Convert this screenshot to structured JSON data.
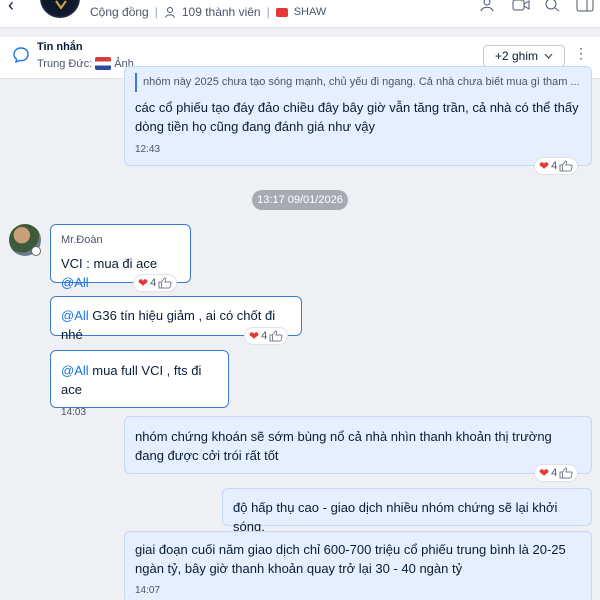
{
  "header": {
    "community_label": "Cộng đồng",
    "members_label": "109 thành viên",
    "tag_label": "SHAW"
  },
  "pinned": {
    "title": "Tin nhắn",
    "sender": "Trung Đức:",
    "attachment_label": "Ảnh",
    "more_pins_label": "+2 ghim",
    "more_icon": "⋮"
  },
  "messages": {
    "m1": {
      "quote": "nhóm này 2025 chưa tạo sóng mạnh, chủ yếu đi ngang. Cả nhà chưa biết mua gì tham ...",
      "text": "các cổ phiếu tạo đáy đảo chiều đây bây giờ vẫn tăng trần, cả nhà có thể thấy dòng tiền họ cũng đang đánh giá như vậy",
      "time": "12:43",
      "reaction_count": "4"
    },
    "date_chip": "13:17 09/01/2026",
    "m2": {
      "sender": "Mr.Đoàn",
      "prefix": "VCI : mua đi ace ",
      "mention": "@All",
      "reaction_count": "4"
    },
    "m3": {
      "mention": "@All",
      "text": " G36 tín hiệu giảm , ai có chốt đi nhé",
      "reaction_count": "4"
    },
    "m4": {
      "mention": "@All",
      "text": " mua full VCI , fts đi ace",
      "time": "14:03"
    },
    "m5": {
      "text": "nhóm chứng khoán sẽ sớm bùng nổ cả nhà nhìn thanh khoản thị trường đang được cởi trói rất tốt",
      "reaction_count": "4"
    },
    "m6": {
      "text": "độ hấp thụ cao - giao dịch nhiều nhóm chứng sẽ lại khởi sóng."
    },
    "m7": {
      "text": "giai đoạn cuối năm giao dịch chỉ 600-700 triệu cổ phiếu trung bình là 20-25 ngàn tỷ, bây giờ thanh khoản quay trở lại 30 - 40 ngàn tỷ",
      "time": "14:07"
    }
  }
}
